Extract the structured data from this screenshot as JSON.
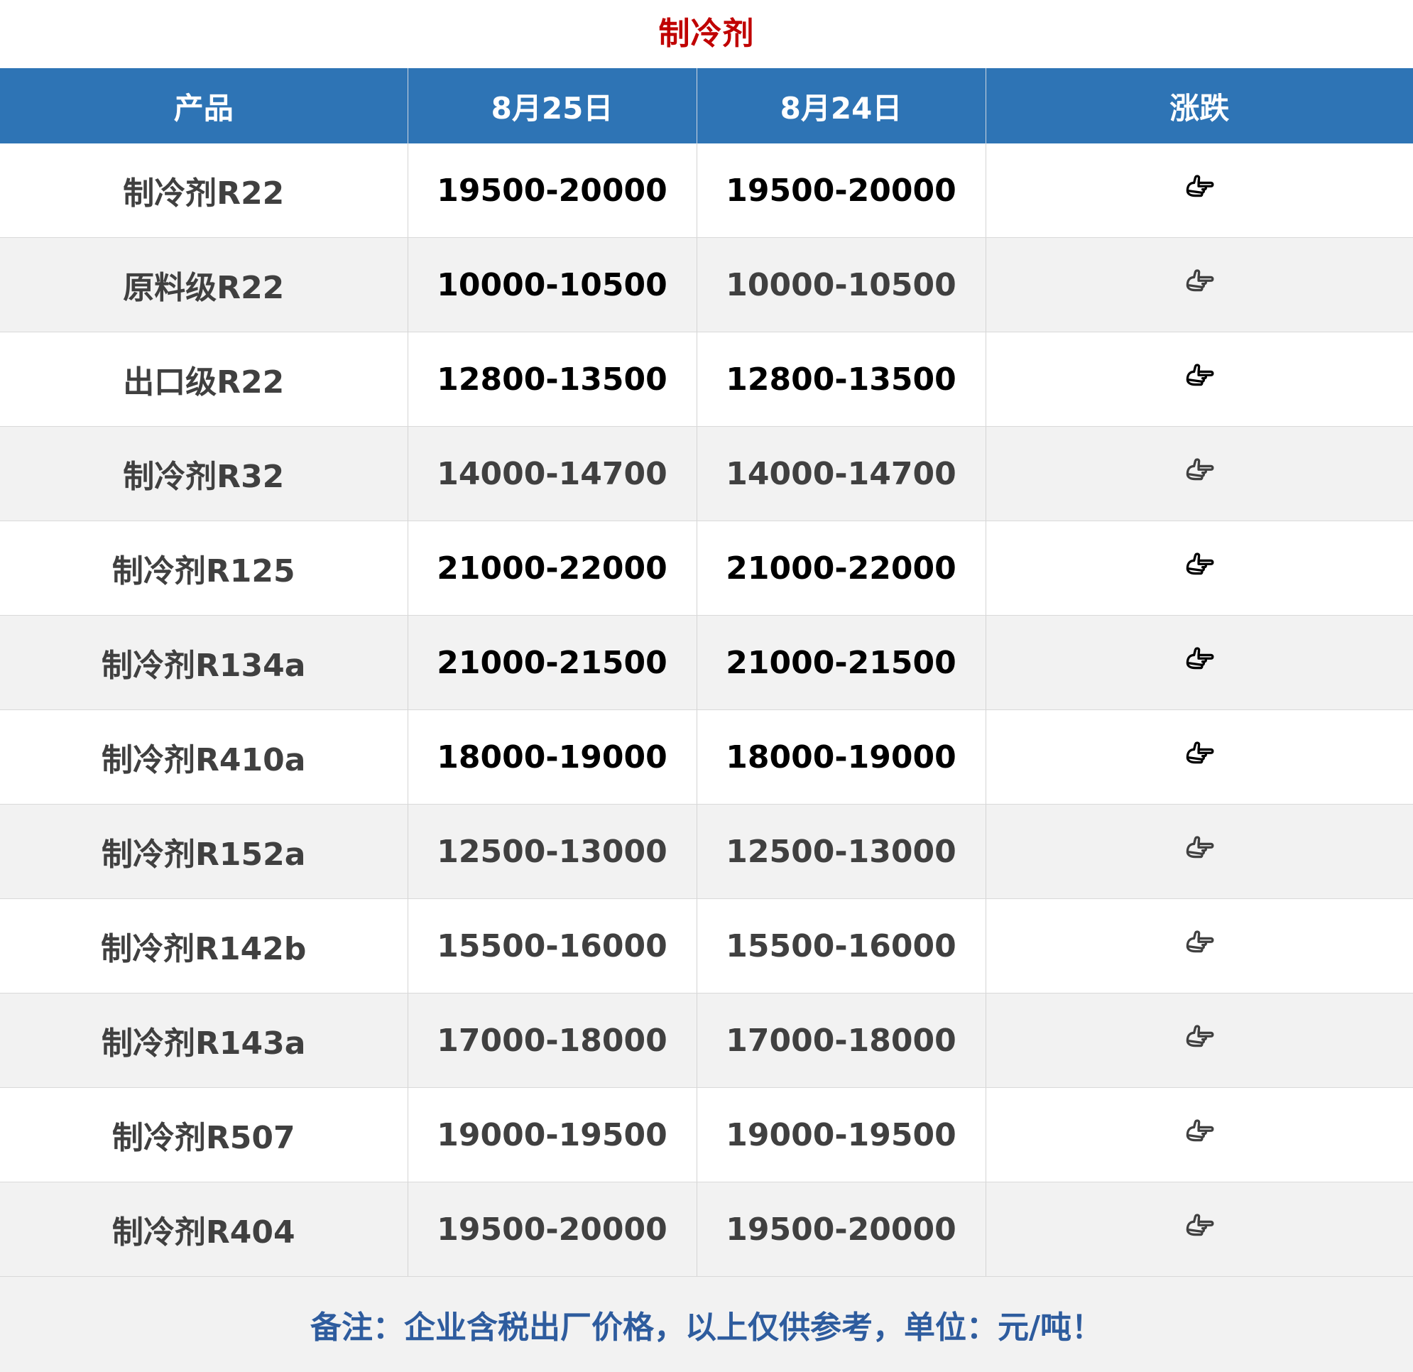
{
  "title": "制冷剂",
  "table": {
    "headers": [
      "产品",
      "8月25日",
      "8月24日",
      "涨跌"
    ],
    "rows": [
      {
        "product": "制冷剂R22",
        "aug25": "19500-20000",
        "aug24": "19500-20000",
        "change_icon": "pointing-hand-right-icon",
        "tone": "dark"
      },
      {
        "product": "原料级R22",
        "aug25": "10000-10500",
        "aug24": "10000-10500",
        "change_icon": "pointing-hand-right-icon",
        "tone": "mixed"
      },
      {
        "product": "出口级R22",
        "aug25": "12800-13500",
        "aug24": "12800-13500",
        "change_icon": "pointing-hand-right-icon",
        "tone": "dark"
      },
      {
        "product": "制冷剂R32",
        "aug25": "14000-14700",
        "aug24": "14000-14700",
        "change_icon": "pointing-hand-right-icon",
        "tone": "grey"
      },
      {
        "product": "制冷剂R125",
        "aug25": "21000-22000",
        "aug24": "21000-22000",
        "change_icon": "pointing-hand-right-icon",
        "tone": "dark"
      },
      {
        "product": "制冷剂R134a",
        "aug25": "21000-21500",
        "aug24": "21000-21500",
        "change_icon": "pointing-hand-right-icon",
        "tone": "dark"
      },
      {
        "product": "制冷剂R410a",
        "aug25": "18000-19000",
        "aug24": "18000-19000",
        "change_icon": "pointing-hand-right-icon",
        "tone": "dark"
      },
      {
        "product": "制冷剂R152a",
        "aug25": "12500-13000",
        "aug24": "12500-13000",
        "change_icon": "pointing-hand-right-icon",
        "tone": "grey"
      },
      {
        "product": "制冷剂R142b",
        "aug25": "15500-16000",
        "aug24": "15500-16000",
        "change_icon": "pointing-hand-right-icon",
        "tone": "grey"
      },
      {
        "product": "制冷剂R143a",
        "aug25": "17000-18000",
        "aug24": "17000-18000",
        "change_icon": "pointing-hand-right-icon",
        "tone": "grey"
      },
      {
        "product": "制冷剂R507",
        "aug25": "19000-19500",
        "aug24": "19000-19500",
        "change_icon": "pointing-hand-right-icon",
        "tone": "grey"
      },
      {
        "product": "制冷剂R404",
        "aug25": "19500-20000",
        "aug24": "19500-20000",
        "change_icon": "pointing-hand-right-icon",
        "tone": "grey"
      }
    ]
  },
  "footer_note": "备注：企业含税出厂价格，以上仅供参考，单位：元/吨！",
  "colors": {
    "title": "#c00000",
    "header_bg": "#2e74b5",
    "header_text": "#ffffff",
    "row_alt_bg": "#f2f2f2",
    "note_text": "#2e5c9e"
  }
}
